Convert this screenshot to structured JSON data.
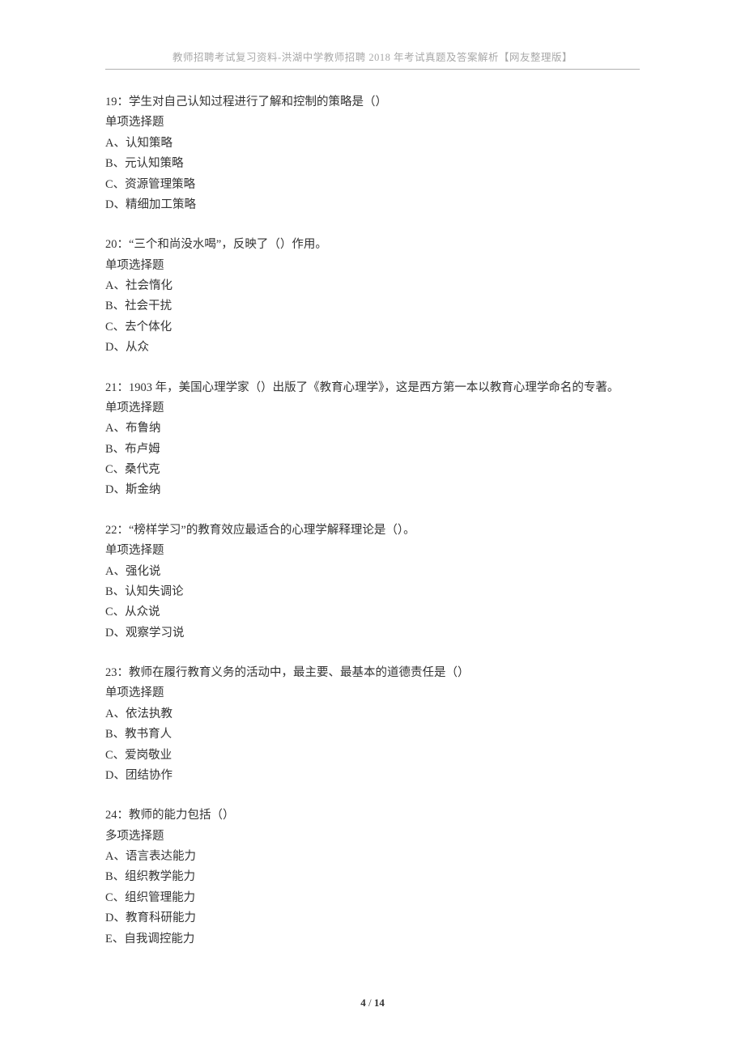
{
  "header": "教师招聘考试复习资料-洪湖中学教师招聘 2018 年考试真题及答案解析【网友整理版】",
  "questions": [
    {
      "number": "19",
      "stem": "：学生对自己认知过程进行了解和控制的策略是（）",
      "qtype": "单项选择题",
      "options": [
        "A、认知策略",
        "B、元认知策略",
        "C、资源管理策略",
        "D、精细加工策略"
      ]
    },
    {
      "number": "20",
      "stem": "：“三个和尚没水喝”，反映了（）作用。",
      "qtype": "单项选择题",
      "options": [
        "A、社会惰化",
        "B、社会干扰",
        "C、去个体化",
        "D、从众"
      ]
    },
    {
      "number": "21",
      "stem": "：1903 年，美国心理学家（）出版了《教育心理学》，这是西方第一本以教育心理学命名的专著。",
      "qtype": "单项选择题",
      "options": [
        "A、布鲁纳",
        "B、布卢姆",
        "C、桑代克",
        "D、斯金纳"
      ]
    },
    {
      "number": "22",
      "stem": "：“榜样学习”的教育效应最适合的心理学解释理论是（）。",
      "qtype": "单项选择题",
      "options": [
        "A、强化说",
        "B、认知失调论",
        "C、从众说",
        "D、观察学习说"
      ]
    },
    {
      "number": "23",
      "stem": "：教师在履行教育义务的活动中，最主要、最基本的道德责任是（）",
      "qtype": "单项选择题",
      "options": [
        "A、依法执教",
        "B、教书育人",
        "C、爱岗敬业",
        "D、团结协作"
      ]
    },
    {
      "number": "24",
      "stem": "：教师的能力包括（）",
      "qtype": "多项选择题",
      "options": [
        "A、语言表达能力",
        "B、组织教学能力",
        "C、组织管理能力",
        "D、教育科研能力",
        "E、自我调控能力"
      ]
    }
  ],
  "footer": {
    "page_current": "4",
    "page_sep": " / ",
    "page_total": "14"
  }
}
